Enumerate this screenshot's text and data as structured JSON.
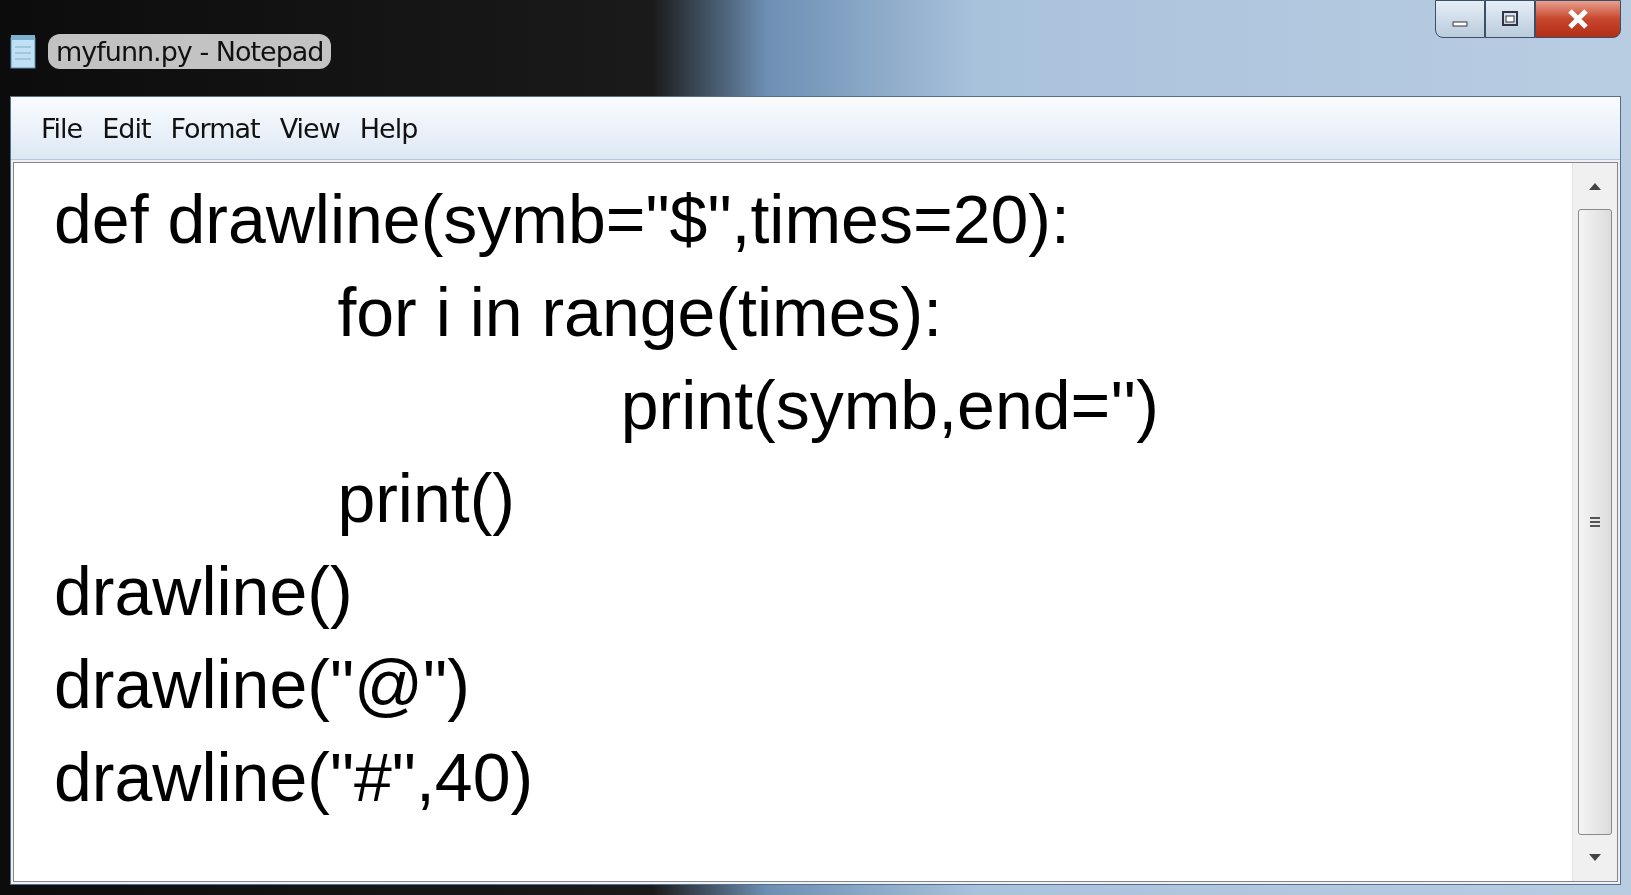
{
  "window": {
    "title": "myfunn.py - Notepad"
  },
  "menu": [
    "File",
    "Edit",
    "Format",
    "View",
    "Help"
  ],
  "editor": {
    "text": "def drawline(symb=\"$\",times=20):\n\tfor i in range(times):\n\t\tprint(symb,end='')\n\tprint()\ndrawline()\ndrawline(\"@\")\ndrawline(\"#\",40)"
  }
}
